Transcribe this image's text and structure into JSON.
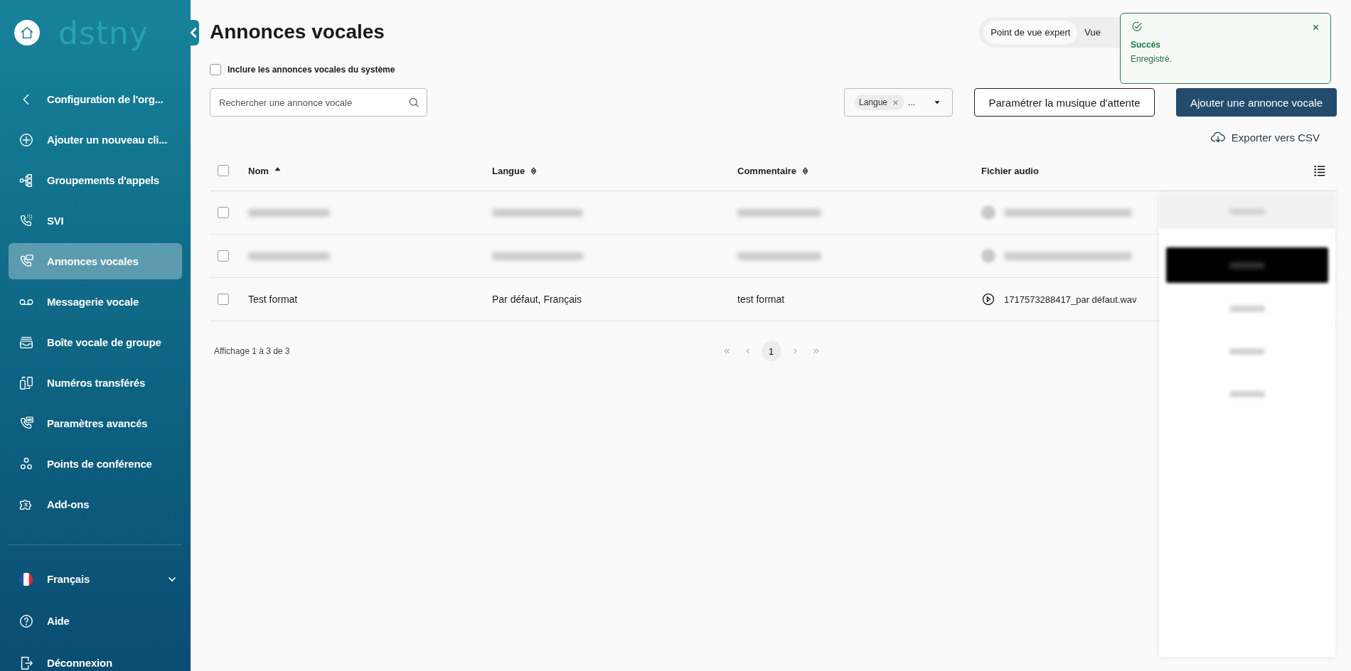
{
  "sidebar": {
    "logo": "dstny",
    "back_item": {
      "label": "Configuration de l'org..."
    },
    "items": [
      {
        "label": "Ajouter un nouveau cli...",
        "selected": false
      },
      {
        "label": "Groupements d'appels",
        "selected": false
      },
      {
        "label": "SVI",
        "selected": false
      },
      {
        "label": "Annonces vocales",
        "selected": true
      },
      {
        "label": "Messagerie vocale",
        "selected": false
      },
      {
        "label": "Boîte vocale de groupe",
        "selected": false
      },
      {
        "label": "Numéros transférés",
        "selected": false
      },
      {
        "label": "Paramètres avancés",
        "selected": false
      },
      {
        "label": "Points de conférence",
        "selected": false
      },
      {
        "label": "Add-ons",
        "selected": false
      }
    ],
    "bottom_items": [
      {
        "kind": "language",
        "label": "Français",
        "expanded": false
      },
      {
        "kind": "link",
        "label": "Aide"
      },
      {
        "kind": "link",
        "label": "Déconnexion"
      }
    ]
  },
  "page": {
    "title": "Annonces vocales",
    "view_toggle": [
      {
        "label": "Point de vue expert",
        "selected": true
      },
      {
        "label": "Vue",
        "selected": false
      }
    ],
    "include_system": {
      "label": "Inclure les annonces vocales du système",
      "checked": false
    },
    "search": {
      "placeholder": "Rechercher une annonce vocale"
    },
    "filter": {
      "chip": "Langue",
      "more": "..."
    },
    "buttons": [
      {
        "kind": "outline",
        "label": "Paramétrer la musique d'attente"
      },
      {
        "kind": "primary",
        "label": "Ajouter une annonce vocale"
      }
    ],
    "export": "Exporter vers CSV"
  },
  "table": {
    "all_checked": false,
    "columns": [
      {
        "label": "Nom",
        "kind": "sorted"
      },
      {
        "label": "Langue",
        "kind": "sortable"
      },
      {
        "label": "Commentaire",
        "kind": "sortable"
      },
      {
        "label": "Fichier audio",
        "kind": "plain"
      }
    ],
    "rows": [
      {
        "kind": "blurred",
        "checked": false
      },
      {
        "kind": "blurred",
        "checked": false
      },
      {
        "kind": "normal",
        "checked": false,
        "name": "Test format",
        "language": "Par défaut, Français",
        "comment": "test format",
        "audio_file": "1717573288417_par défaut.wav"
      }
    ],
    "summary": "Affichage 1 à 3 de 3",
    "pages": [
      {
        "label": "1",
        "selected": true
      }
    ]
  },
  "side_panel": {
    "items": [
      {
        "kind": "header"
      },
      {
        "kind": "highlight"
      },
      {
        "kind": "plain"
      },
      {
        "kind": "plain"
      },
      {
        "kind": "plain"
      }
    ]
  },
  "toast": {
    "title": "Succès",
    "message": "Enregistré."
  }
}
